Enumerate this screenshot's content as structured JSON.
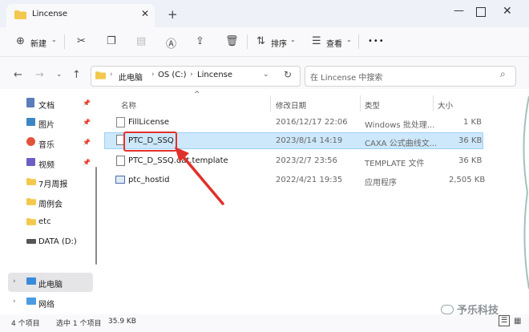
{
  "window": {
    "tab_title": "Lincense",
    "new_tab": "+",
    "close_tab": "✕"
  },
  "toolbar": {
    "new_label": "新建",
    "sort_label": "排序",
    "view_label": "查看",
    "more": "•••"
  },
  "address": {
    "crumbs": [
      "此电脑",
      "OS (C:)",
      "Lincense"
    ],
    "search_placeholder": "在 Lincense 中搜索"
  },
  "sidebar": {
    "items": [
      {
        "label": "文档",
        "icon": "document-icon",
        "pinned": true
      },
      {
        "label": "图片",
        "icon": "picture-icon",
        "pinned": true
      },
      {
        "label": "音乐",
        "icon": "music-icon",
        "pinned": true
      },
      {
        "label": "视频",
        "icon": "video-icon",
        "pinned": true
      },
      {
        "label": "7月周报",
        "icon": "folder-icon",
        "pinned": false
      },
      {
        "label": "周例会",
        "icon": "folder-icon",
        "pinned": false
      },
      {
        "label": "etc",
        "icon": "folder-icon",
        "pinned": false
      },
      {
        "label": "DATA (D:)",
        "icon": "drive-icon",
        "pinned": false
      },
      {
        "label": "此电脑",
        "icon": "computer-icon",
        "pinned": false
      },
      {
        "label": "网络",
        "icon": "network-icon",
        "pinned": false
      }
    ]
  },
  "columns": {
    "name": "名称",
    "modified": "修改日期",
    "type": "类型",
    "size": "大小"
  },
  "files": [
    {
      "name": "FillLicense",
      "modified": "2016/12/17 22:06",
      "type": "Windows 批处理...",
      "size": "1 KB"
    },
    {
      "name": "PTC_D_SSQ",
      "modified": "2023/8/14 14:19",
      "type": "CAXA 公式曲线文...",
      "size": "36 KB"
    },
    {
      "name": "PTC_D_SSQ.dat.template",
      "modified": "2023/2/7 23:56",
      "type": "TEMPLATE 文件",
      "size": "36 KB"
    },
    {
      "name": "ptc_hostid",
      "modified": "2022/4/21 19:35",
      "type": "应用程序",
      "size": "2,505 KB"
    }
  ],
  "status": {
    "count": "4 个项目",
    "selected": "选中 1 个项目",
    "size": "35.9 KB"
  },
  "watermark": "予乐科技",
  "colors": {
    "selection": "#cde8fb",
    "highlight_box": "#e0312a",
    "folder": "#f3c84c"
  }
}
